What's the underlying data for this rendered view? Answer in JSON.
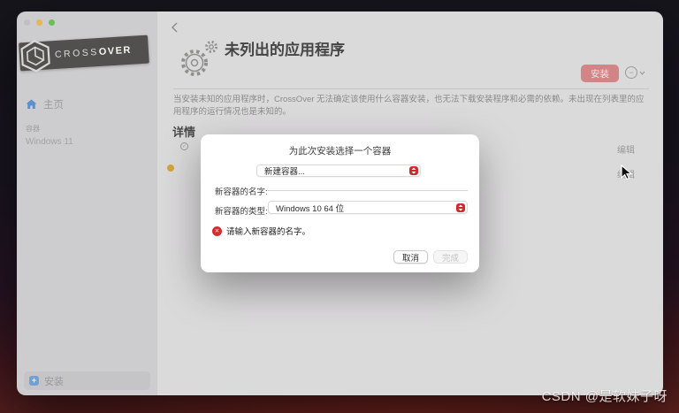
{
  "sidebar": {
    "logo": {
      "cross": "CROSS",
      "over": "OVER"
    },
    "home_label": "主页",
    "containers_section_label": "容器",
    "container_name": "Windows 11",
    "install_label": "安装"
  },
  "header": {
    "title": "未列出的应用程序",
    "install_button_label": "安装"
  },
  "main": {
    "description": "当安装未知的应用程序时，CrossOver 无法确定该使用什么容器安装，也无法下载安装程序和必需的依赖。未出现在列表里的应用程序的运行情况也是未知的。",
    "details_heading": "详情",
    "rows": [
      {
        "edit_label": "编辑"
      },
      {
        "edit_label": "编辑"
      }
    ]
  },
  "dialog": {
    "title": "为此次安装选择一个容器",
    "container_select_value": "新建容器...",
    "name_label": "新容器的名字:",
    "type_label": "新容器的类型:",
    "type_select_value": "Windows 10 64 位",
    "error_message": "请输入新容器的名字。",
    "cancel_button": "取消",
    "done_button": "完成"
  },
  "icons": {
    "options_minus": "−",
    "check": "✓",
    "close_x": "✕",
    "plus": "+"
  },
  "colors": {
    "accent_red": "#cb2a2e",
    "install_button": "#d18586",
    "home_icon_blue": "#5c8fd2",
    "warning_yellow": "#d2a53c",
    "error_red": "#d02f2f"
  },
  "watermark": "CSDN @是软妹子呀"
}
